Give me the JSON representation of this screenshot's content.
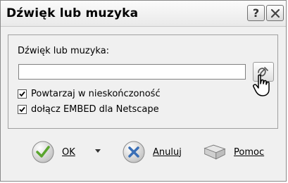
{
  "window": {
    "title": "Dźwięk lub muzyka"
  },
  "titlebar": {
    "help_label": "?",
    "close_label": "✕"
  },
  "field": {
    "label": "Dźwięk lub muzyka:",
    "value": ""
  },
  "checkboxes": [
    {
      "label": "Powtarzaj w nieskończoność",
      "checked": true
    },
    {
      "label": "dołącz EMBED dla Netscape",
      "checked": true
    }
  ],
  "buttons": {
    "ok_label": "OK",
    "cancel_label": "Anuluj",
    "help_label": "Pomoc"
  },
  "colors": {
    "ok_green": "#5aa52e",
    "cancel_blue": "#3a6fb6"
  }
}
